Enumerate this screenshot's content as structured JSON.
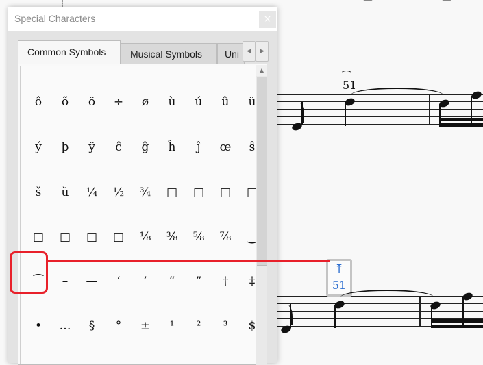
{
  "dialog": {
    "title": "Special Characters",
    "close_icon": "×",
    "tabs": [
      {
        "label": "Common Symbols",
        "active": true
      },
      {
        "label": "Musical Symbols",
        "active": false
      },
      {
        "label": "Unicode Symbols",
        "visible_label": "Uni",
        "active": false
      }
    ],
    "tab_scroll_left": "◀",
    "tab_scroll_right": "▶",
    "scroll_up": "▲",
    "grid": [
      [
        "ô",
        "õ",
        "ö",
        "÷",
        "ø",
        "ù",
        "ú",
        "û",
        "ü"
      ],
      [
        "ý",
        "þ",
        "ÿ",
        "ĉ",
        "ĝ",
        "ĥ",
        "ĵ",
        "œ",
        "ŝ"
      ],
      [
        "š",
        "ŭ",
        "¼",
        "½",
        "¾",
        "□",
        "□",
        "□",
        "□"
      ],
      [
        "□",
        "□",
        "□",
        "□",
        "⅛",
        "⅜",
        "⅝",
        "⅞",
        "‿"
      ],
      [
        "⁀",
        "–",
        "—",
        "‘",
        "’",
        "“",
        "”",
        "†",
        "‡"
      ],
      [
        "•",
        "…",
        "§",
        "°",
        "±",
        "¹",
        "²",
        "³",
        "$"
      ]
    ],
    "highlighted_symbol": "⁀"
  },
  "score": {
    "top_fingering": "51",
    "top_arc": "⁀",
    "edit_glyph": "⤒",
    "edit_fingering": "51"
  },
  "annotation": {
    "color": "#e8202a"
  }
}
